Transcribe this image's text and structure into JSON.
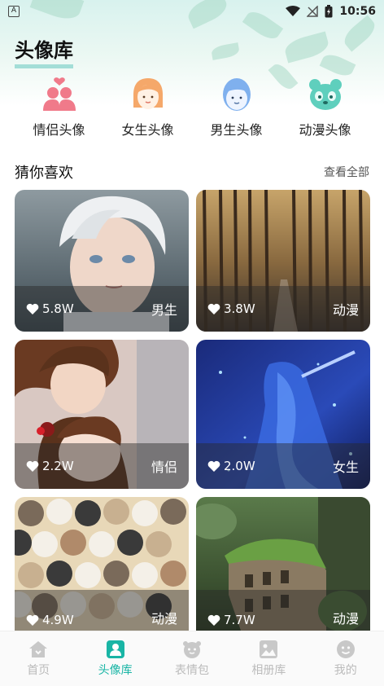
{
  "status_bar": {
    "app_icon_label": "A",
    "time": "10:56"
  },
  "page": {
    "title": "头像库"
  },
  "categories": [
    {
      "label": "情侣头像",
      "icon": "couple-icon"
    },
    {
      "label": "女生头像",
      "icon": "girl-icon"
    },
    {
      "label": "男生头像",
      "icon": "boy-icon"
    },
    {
      "label": "动漫头像",
      "icon": "panda-icon"
    }
  ],
  "section": {
    "title": "猜你喜欢",
    "see_all": "查看全部"
  },
  "cards": [
    {
      "likes": "5.8W",
      "tag": "男生",
      "image": "anime-boy-portrait"
    },
    {
      "likes": "3.8W",
      "tag": "动漫",
      "image": "forest-path"
    },
    {
      "likes": "2.2W",
      "tag": "情侣",
      "image": "anime-couple"
    },
    {
      "likes": "2.0W",
      "tag": "女生",
      "image": "blue-anime-girl"
    },
    {
      "likes": "4.9W",
      "tag": "动漫",
      "image": "cat-pattern"
    },
    {
      "likes": "7.7W",
      "tag": "动漫",
      "image": "overgrown-ruins"
    }
  ],
  "bottom_nav": [
    {
      "label": "首页",
      "icon": "home-icon",
      "active": false
    },
    {
      "label": "头像库",
      "icon": "avatar-icon",
      "active": true
    },
    {
      "label": "表情包",
      "icon": "emoji-icon",
      "active": false
    },
    {
      "label": "相册库",
      "icon": "album-icon",
      "active": false
    },
    {
      "label": "我的",
      "icon": "profile-icon",
      "active": false
    }
  ],
  "colors": {
    "accent": "#19b5a5",
    "nav_inactive": "#bbbbbb"
  }
}
